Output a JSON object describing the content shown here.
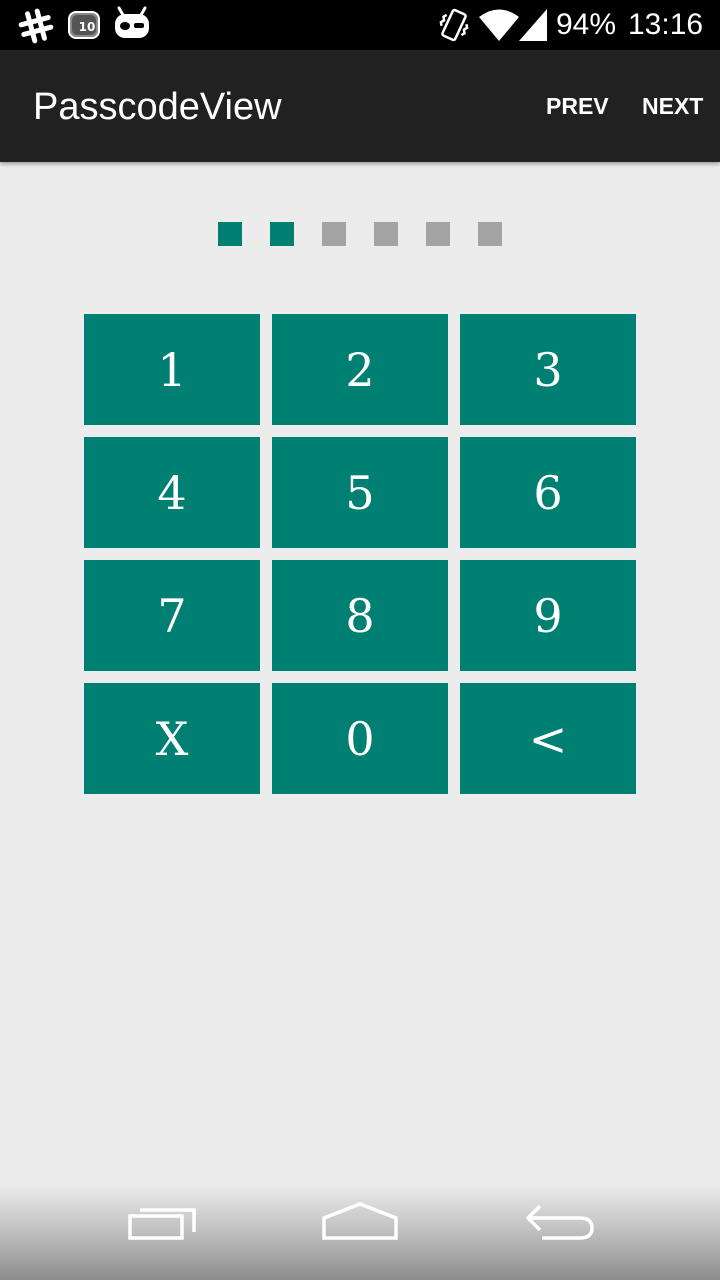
{
  "status_bar": {
    "icons": [
      "hashtag-icon",
      "notification-counter-icon",
      "cyanogen-mascot-icon",
      "vibrate-icon",
      "wifi-icon",
      "cell-signal-icon"
    ],
    "notification_count": "10",
    "battery": "94%",
    "time": "13:16"
  },
  "action_bar": {
    "title": "PasscodeView",
    "prev_label": "PREV",
    "next_label": "NEXT"
  },
  "passcode": {
    "length": 6,
    "entered": 2,
    "filled_color": "#008073",
    "empty_color": "#a3a3a3"
  },
  "keypad": {
    "key_color": "#008073",
    "keys": [
      "1",
      "2",
      "3",
      "4",
      "5",
      "6",
      "7",
      "8",
      "9",
      "X",
      "0",
      "<"
    ]
  },
  "nav_bar": {
    "icons": [
      "recent-apps-icon",
      "home-icon",
      "back-icon"
    ]
  }
}
